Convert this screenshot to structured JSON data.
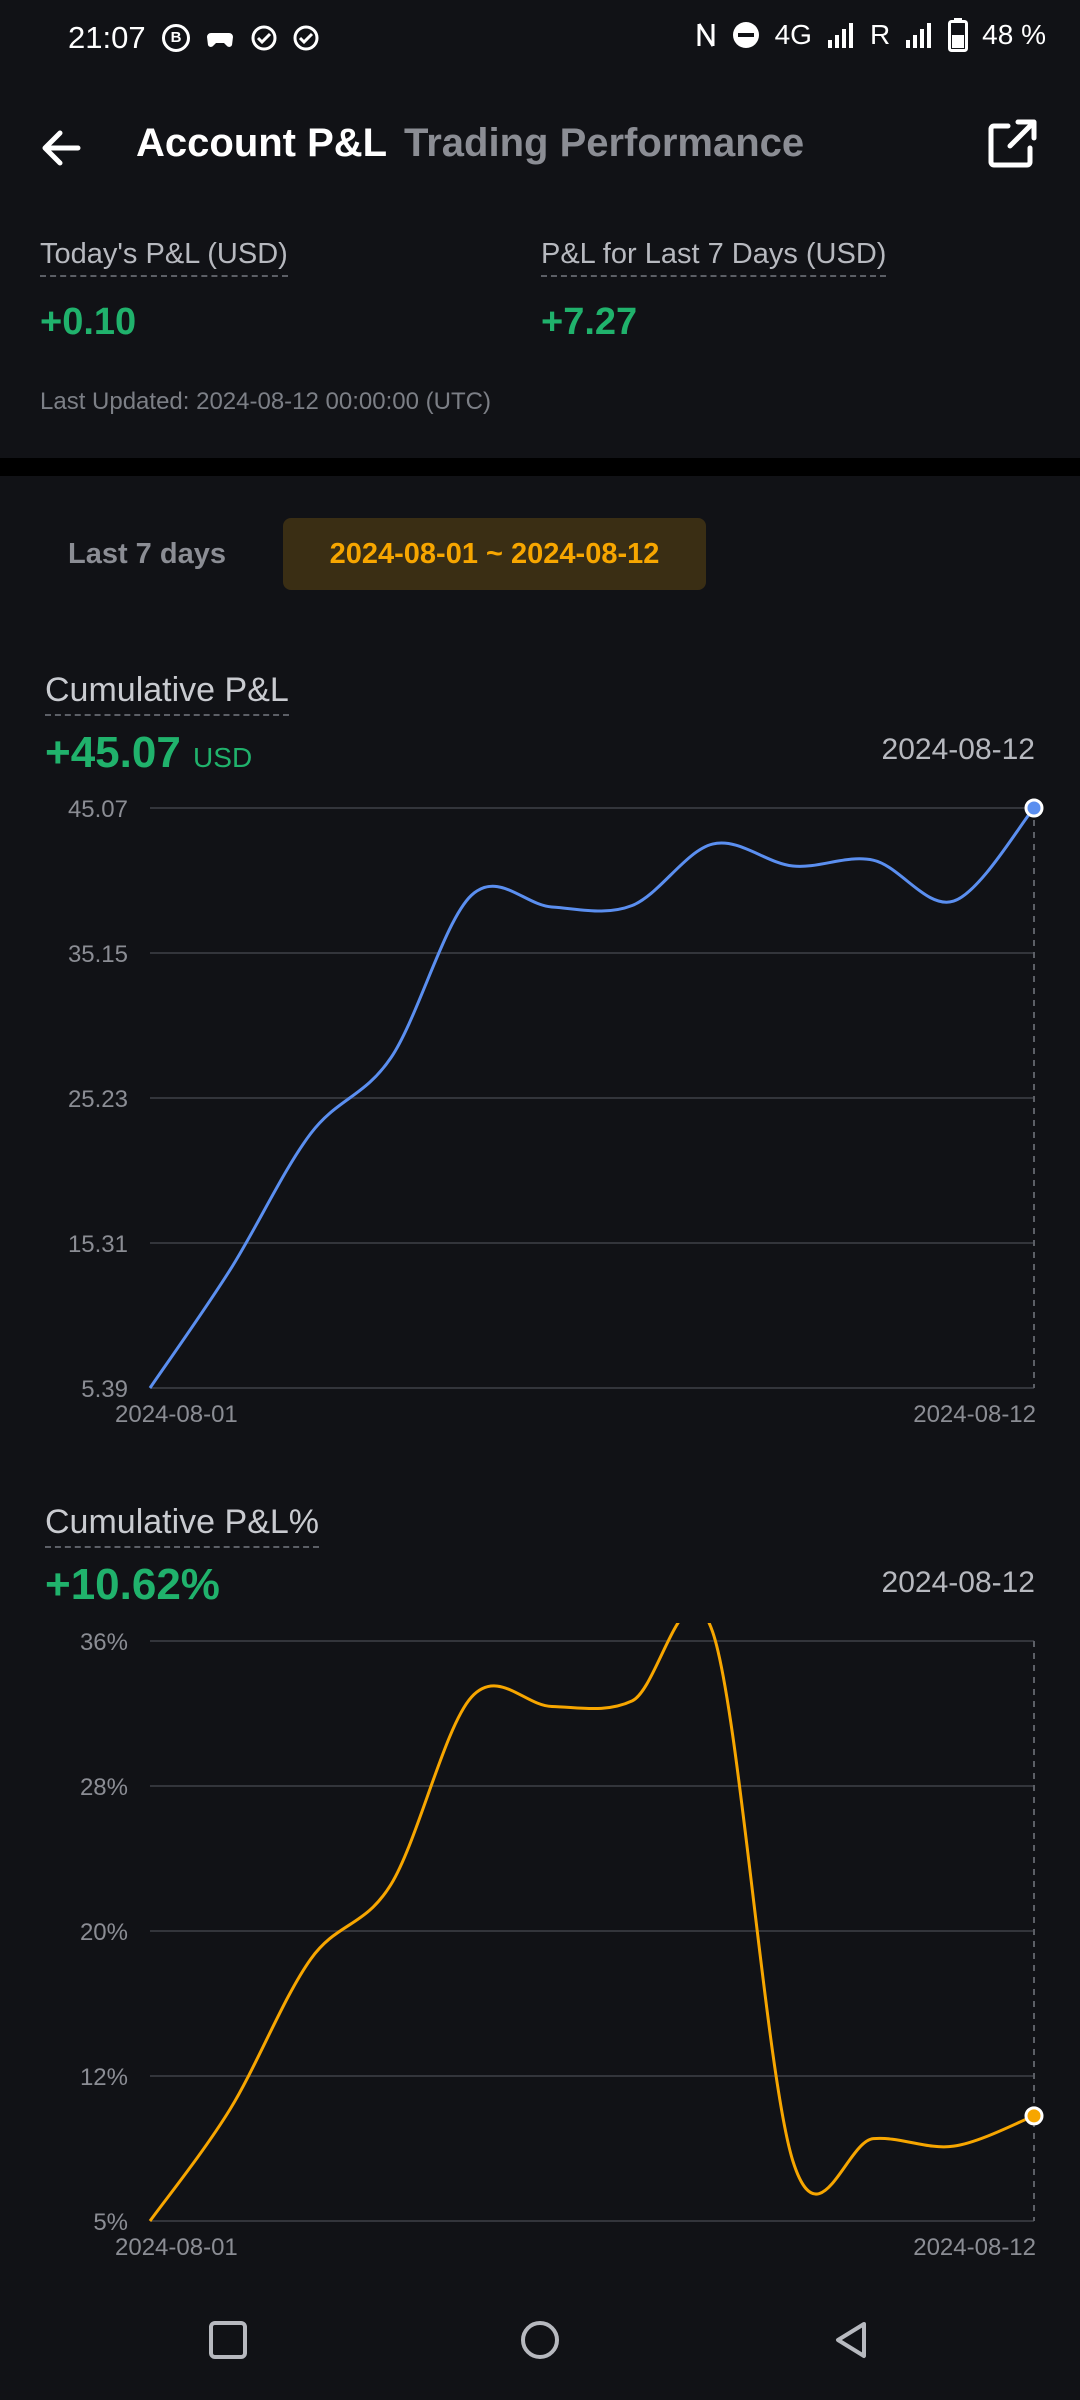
{
  "status_bar": {
    "time": "21:07",
    "left_icons": [
      "b-circle-icon",
      "game-controller-icon",
      "check-circle-icon",
      "check-circle-icon"
    ],
    "network": "4G",
    "roaming": "R",
    "battery": "48 %"
  },
  "header": {
    "tab_active": "Account P&L",
    "tab_inactive": "Trading Performance"
  },
  "summary": {
    "today_label": "Today's P&L (USD)",
    "today_value": "+0.10",
    "week_label": "P&L for Last 7 Days (USD)",
    "week_value": "+7.27",
    "updated": "Last Updated: 2024-08-12 00:00:00 (UTC)"
  },
  "range_tabs": {
    "last7": "Last 7 days",
    "range": "2024-08-01 ~ 2024-08-12"
  },
  "colors": {
    "green": "#20b26c",
    "blue_line": "#5b8ff0",
    "orange_line": "#f7a600",
    "bg": "#111216"
  },
  "cum_pnl": {
    "title": "Cumulative P&L",
    "value": "+45.07",
    "unit": "USD",
    "date": "2024-08-12"
  },
  "cum_pnl_pct": {
    "title": "Cumulative P&L%",
    "value": "+10.62%",
    "date": "2024-08-12"
  },
  "chart_data": [
    {
      "type": "line",
      "title": "Cumulative P&L",
      "x": [
        "2024-08-01",
        "2024-08-02",
        "2024-08-03",
        "2024-08-04",
        "2024-08-05",
        "2024-08-06",
        "2024-08-07",
        "2024-08-08",
        "2024-08-09",
        "2024-08-10",
        "2024-08-11",
        "2024-08-12"
      ],
      "series": [
        {
          "values": [
            5.39,
            13.5,
            22.8,
            28.0,
            39.1,
            38.3,
            38.4,
            42.6,
            41.1,
            41.5,
            38.7,
            45.07
          ]
        }
      ],
      "xticks": [
        "2024-08-01",
        "2024-08-12"
      ],
      "yticks": [
        "45.07",
        "35.15",
        "25.23",
        "15.31",
        "5.39"
      ],
      "ylim": [
        5.39,
        45.07
      ],
      "grid": true,
      "color": "#5b8ff0"
    },
    {
      "type": "line",
      "title": "Cumulative P&L%",
      "x": [
        "2024-08-01",
        "2024-08-02",
        "2024-08-03",
        "2024-08-04",
        "2024-08-05",
        "2024-08-06",
        "2024-08-07",
        "2024-08-08",
        "2024-08-09",
        "2024-08-10",
        "2024-08-11",
        "2024-08-12"
      ],
      "series": [
        {
          "values": [
            5.0,
            11.0,
            19.0,
            23.0,
            33.0,
            32.5,
            32.8,
            36.5,
            8.2,
            9.4,
            9.0,
            10.62
          ]
        }
      ],
      "xticks": [
        "2024-08-01",
        "2024-08-12"
      ],
      "yticks": [
        "36%",
        "28%",
        "20%",
        "12%",
        "5%"
      ],
      "ylim": [
        5,
        36
      ],
      "grid": true,
      "color": "#f7a600"
    }
  ]
}
